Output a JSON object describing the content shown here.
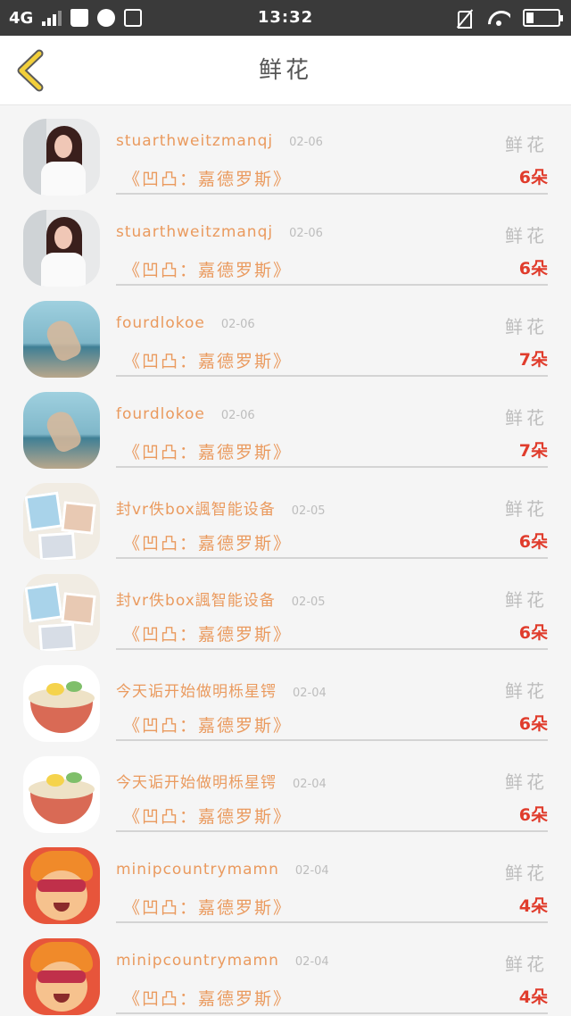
{
  "status_bar": {
    "network": "4G",
    "time": "13:32",
    "icons": [
      "signal-icon",
      "shopping-bag-icon",
      "chat-icon",
      "screenshot-icon",
      "mute-icon",
      "wifi-icon",
      "battery-icon"
    ]
  },
  "header": {
    "title": "鲜花",
    "back_icon": "chevron-left-icon",
    "accent_color": "#f2cf3a"
  },
  "colors": {
    "name": "#ea9a5e",
    "date": "#bdbdbd",
    "count": "#e03c2c",
    "divider": "#d4d4d4"
  },
  "items": [
    {
      "name": "stuarthweitzmanqj",
      "date": "02-06",
      "tag": "鲜花",
      "subject": "《凹凸：嘉德罗斯》",
      "count": "6朵",
      "avatar": "girl-photo"
    },
    {
      "name": "stuarthweitzmanqj",
      "date": "02-06",
      "tag": "鲜花",
      "subject": "《凹凸：嘉德罗斯》",
      "count": "6朵",
      "avatar": "girl-photo"
    },
    {
      "name": "fourdlokoe",
      "date": "02-06",
      "tag": "鲜花",
      "subject": "《凹凸：嘉德罗斯》",
      "count": "7朵",
      "avatar": "sea-hand-photo"
    },
    {
      "name": "fourdlokoe",
      "date": "02-06",
      "tag": "鲜花",
      "subject": "《凹凸：嘉德罗斯》",
      "count": "7朵",
      "avatar": "sea-hand-photo"
    },
    {
      "name": "封vr佚box諷智能设备",
      "date": "02-05",
      "tag": "鲜花",
      "subject": "《凹凸：嘉德罗斯》",
      "count": "6朵",
      "avatar": "photo-collage"
    },
    {
      "name": "封vr佚box諷智能设备",
      "date": "02-05",
      "tag": "鲜花",
      "subject": "《凹凸：嘉德罗斯》",
      "count": "6朵",
      "avatar": "photo-collage"
    },
    {
      "name": "今天诟开始做明栎星锷",
      "date": "02-04",
      "tag": "鲜花",
      "subject": "《凹凸：嘉德罗斯》",
      "count": "6朵",
      "avatar": "noodle-bowl"
    },
    {
      "name": "今天诟开始做明栎星锷",
      "date": "02-04",
      "tag": "鲜花",
      "subject": "《凹凸：嘉德罗斯》",
      "count": "6朵",
      "avatar": "noodle-bowl"
    },
    {
      "name": "minipcountrymamn",
      "date": "02-04",
      "tag": "鲜花",
      "subject": "《凹凸：嘉德罗斯》",
      "count": "4朵",
      "avatar": "cartoon-face"
    },
    {
      "name": "minipcountrymamn",
      "date": "02-04",
      "tag": "鲜花",
      "subject": "《凹凸：嘉德罗斯》",
      "count": "4朵",
      "avatar": "cartoon-face"
    }
  ]
}
